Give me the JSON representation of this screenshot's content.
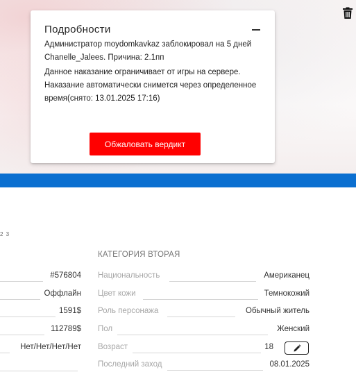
{
  "modal": {
    "title": "Подробности",
    "line1": "Администратор moydomkavkaz заблокировал на 5 дней Chanelle_Jalees. Причина: 2.1пп",
    "line2": "Данное наказание ограничивает от игры на сервере. Наказание автоматически снимется через определенное время(снято: 13.01.2025 17:16)",
    "appeal_button": "Обжаловать вердикт"
  },
  "icons": {
    "trash": "trash-icon",
    "minimize": "minus-icon",
    "edit": "pencil-icon"
  },
  "pager": "2 3",
  "category_two": {
    "title": "КАТЕГОРИЯ ВТОРАЯ",
    "rows": [
      {
        "label": "Национальность",
        "value": "Американец"
      },
      {
        "label": "Цвет кожи",
        "value": "Темнокожий"
      },
      {
        "label": "Роль персонажа",
        "value": "Обычный житель"
      },
      {
        "label": "Пол",
        "value": "Женский"
      },
      {
        "label": "Возраст",
        "value": "18"
      },
      {
        "label": "Последний заход",
        "value": "08.01.2025"
      }
    ]
  },
  "category_one": {
    "rows": [
      {
        "value": "#576804"
      },
      {
        "value": "Оффлайн"
      },
      {
        "value": "1591$"
      },
      {
        "value": "112789$"
      },
      {
        "value": "Нет/Нет/Нет/Нет"
      },
      {
        "value": ""
      }
    ]
  },
  "colors": {
    "accent_blue": "#0b6fd0",
    "appeal_red": "#ff0000"
  }
}
